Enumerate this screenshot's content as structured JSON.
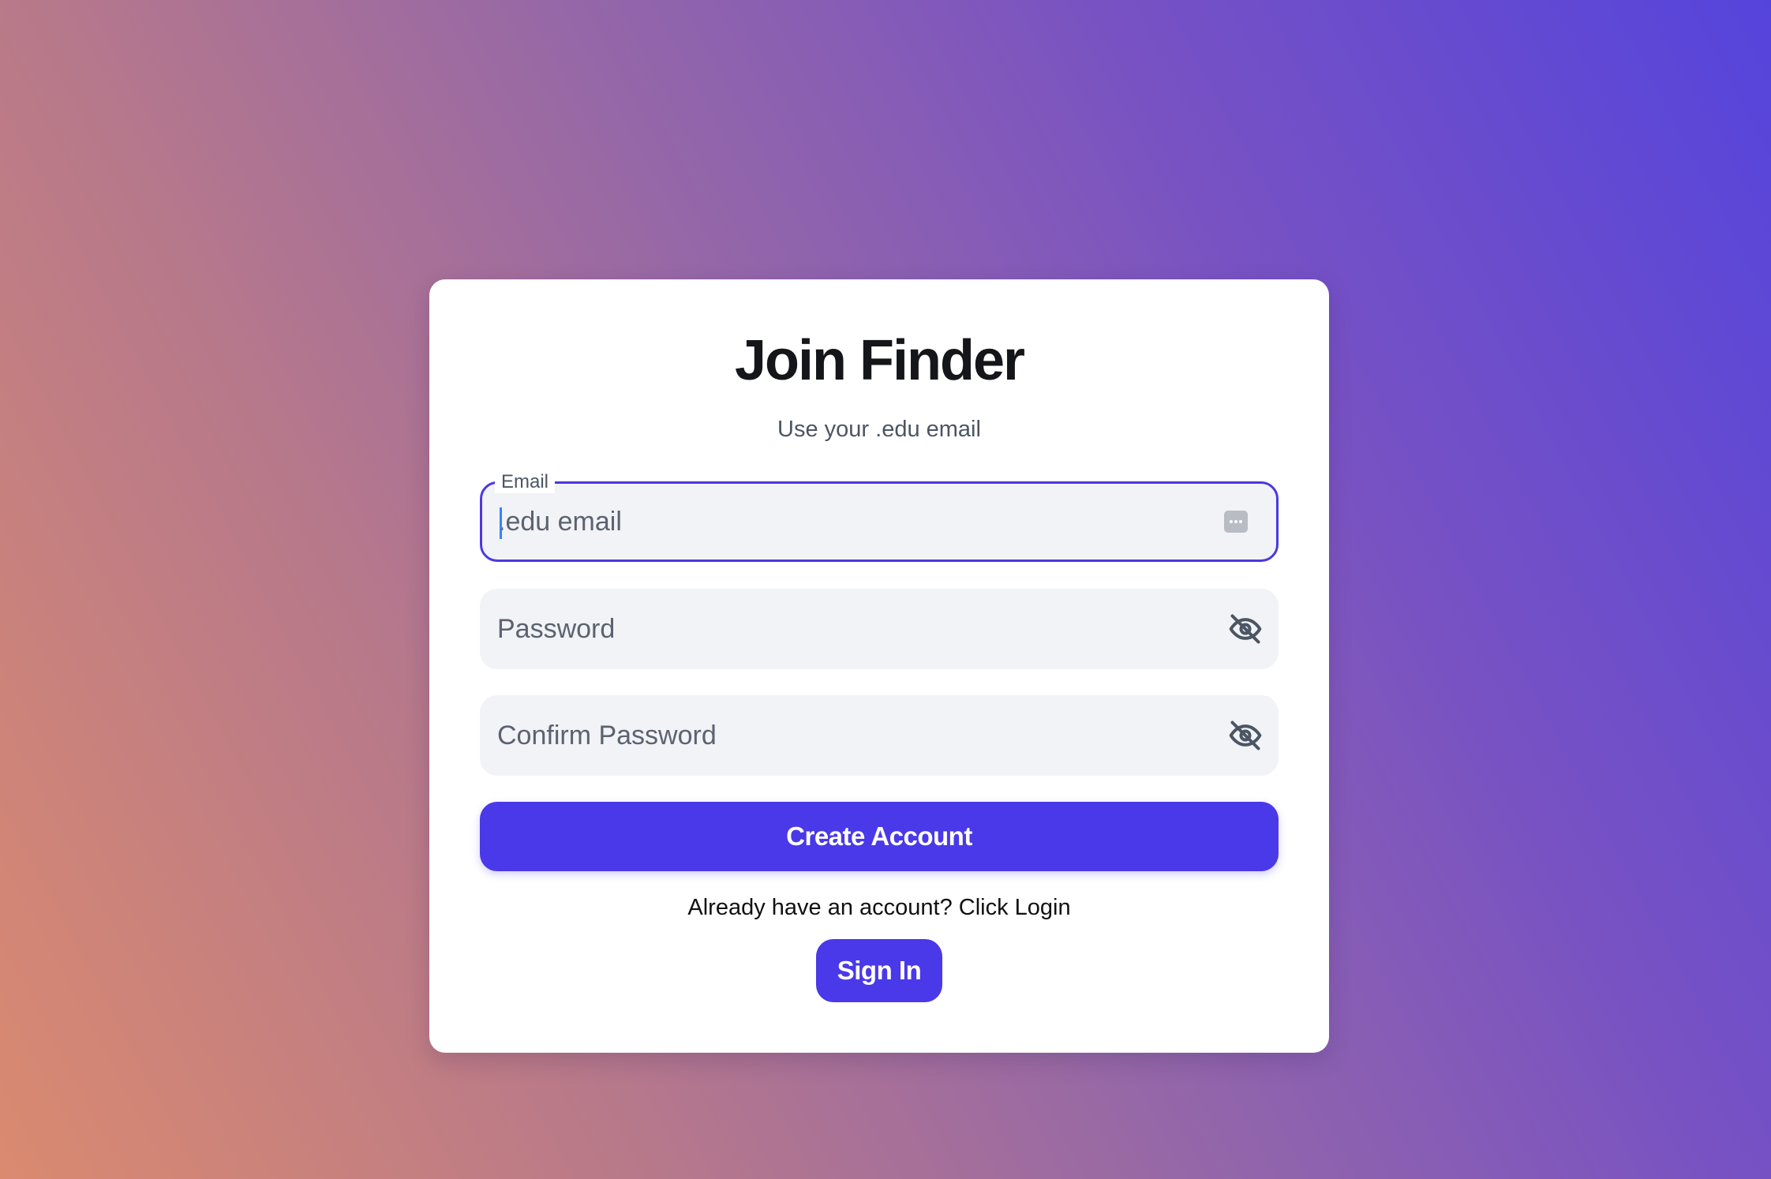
{
  "signup": {
    "title": "Join Finder",
    "subtitle": "Use your .edu email",
    "email": {
      "label": "Email",
      "placeholder": ".edu email",
      "value": ""
    },
    "password": {
      "placeholder": "Password",
      "value": ""
    },
    "confirm_password": {
      "placeholder": "Confirm Password",
      "value": ""
    },
    "create_button": "Create Account",
    "login_prompt": "Already have an account? Click Login",
    "signin_button": "Sign In"
  },
  "icons": {
    "email_autofill": "password-manager-key-icon",
    "password_toggle": "eye-slash-icon",
    "confirm_toggle": "eye-slash-icon"
  },
  "colors": {
    "accent": "#4a39e8",
    "focus_border": "#4a39e0",
    "field_bg": "#f1f3f6",
    "gradient_start": "#da8a6f",
    "gradient_end": "#5544dc"
  }
}
